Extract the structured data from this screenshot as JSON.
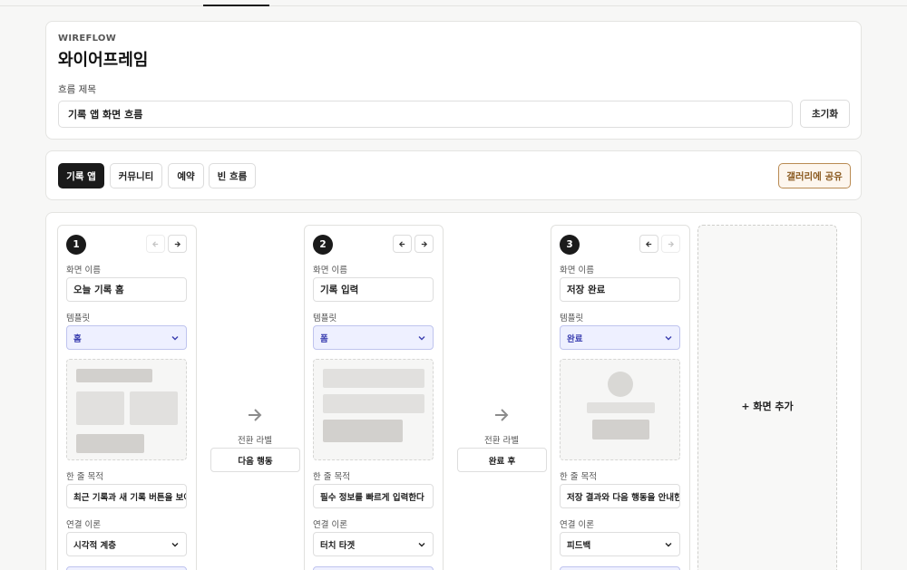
{
  "header": {
    "brand": "WIREFLOW",
    "title": "와이어프레임",
    "flow_title_label": "흐름 제목",
    "flow_title_value": "기록 앱 화면 흐름",
    "reset_label": "초기화"
  },
  "presets": {
    "tabs": [
      {
        "label": "기록 앱",
        "active": true
      },
      {
        "label": "커뮤니티",
        "active": false
      },
      {
        "label": "예약",
        "active": false
      },
      {
        "label": "빈 흐름",
        "active": false
      }
    ],
    "share_label": "갤러리에 공유"
  },
  "field_labels": {
    "screen_name": "화면 이름",
    "template": "템플릿",
    "purpose": "한 줄 목적",
    "theory": "연결 이론",
    "transition": "전환 라벨"
  },
  "screens": [
    {
      "number": "1",
      "name": "오늘 기록 홈",
      "template": "홈",
      "purpose": "최근 기록과 새 기록 버튼을 보여준다",
      "theory": "시각적 계층"
    },
    {
      "number": "2",
      "name": "기록 입력",
      "template": "폼",
      "purpose": "필수 정보를 빠르게 입력한다",
      "theory": "터치 타겟"
    },
    {
      "number": "3",
      "name": "저장 완료",
      "template": "완료",
      "purpose": "저장 결과와 다음 행동을 안내한다",
      "theory": "피드백"
    }
  ],
  "transitions": [
    {
      "label": "다음 행동"
    },
    {
      "label": "완료 후"
    }
  ],
  "add_screen_label": "+ 화면 추가",
  "icons": {
    "prev": "arrow-left-icon",
    "next": "arrow-right-icon",
    "flow": "arrow-right-icon",
    "select": "chevron-down-icon"
  },
  "colors": {
    "primary": "#1a1a1a",
    "template_bg": "#eef0ff",
    "template_text": "#3b3fb0",
    "share_border": "#b98a52",
    "share_text": "#8a5a20"
  }
}
